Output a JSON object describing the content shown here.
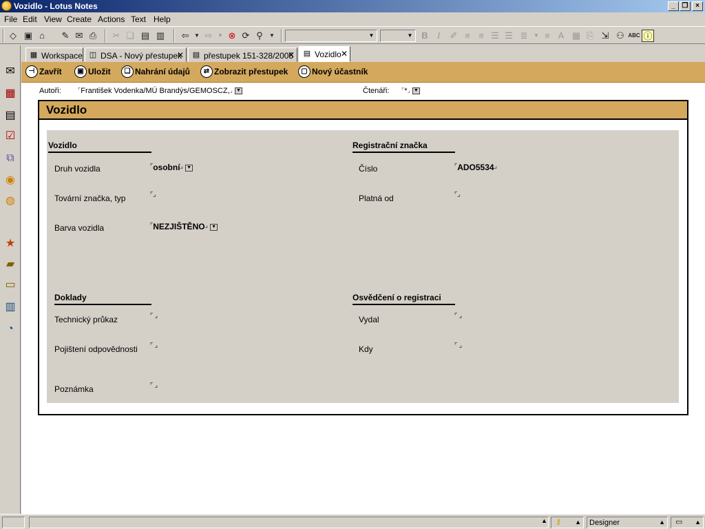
{
  "window": {
    "title": "Vozidlo - Lotus Notes"
  },
  "menu": [
    "File",
    "Edit",
    "View",
    "Create",
    "Actions",
    "Text",
    "Help"
  ],
  "tabs": [
    {
      "label": "Workspace",
      "icon": "workspace-icon"
    },
    {
      "label": "DSA - Nový přestupek",
      "icon": "database-icon"
    },
    {
      "label": "přestupek 151-328/2005",
      "icon": "document-icon"
    },
    {
      "label": "Vozidlo",
      "icon": "document-icon",
      "active": true
    }
  ],
  "actions": [
    {
      "label": "Zavřít",
      "icon": "close-doc-icon"
    },
    {
      "label": "Uložit",
      "icon": "save-icon"
    },
    {
      "label": "Nahrání údajů",
      "icon": "copy-icon"
    },
    {
      "label": "Zobrazit přestupek",
      "icon": "view-icon"
    },
    {
      "label": "Nový účastník",
      "icon": "new-doc-icon"
    }
  ],
  "authors": {
    "label": "Autoři:",
    "value": "František Vodenka/MÚ Brandýs/GEMOSCZ,"
  },
  "readers": {
    "label": "Čtenáři:",
    "value": "*"
  },
  "form": {
    "title": "Vozidlo",
    "vehicle_section": {
      "title": "Vozidlo",
      "type_label": "Druh vozidla",
      "type_value": "osobní",
      "make_label": "Tovární značka, typ",
      "make_value": "",
      "color_label": "Barva vozidla",
      "color_value": "NEZJIŠTĚNO"
    },
    "registration_section": {
      "title": "Registrační značka",
      "number_label": "Číslo",
      "number_value": "ADO5534",
      "valid_label": "Platná od",
      "valid_value": ""
    },
    "documents_section": {
      "title": "Doklady",
      "tech_label": "Technický průkaz",
      "insurance_label": "Pojištení odpovědnosti",
      "note_label": "Poznámka"
    },
    "certificate_section": {
      "title": "Osvědčení o registraci",
      "issued_by_label": "Vydal",
      "when_label": "Kdy"
    }
  },
  "status": {
    "mode": "Designer"
  }
}
